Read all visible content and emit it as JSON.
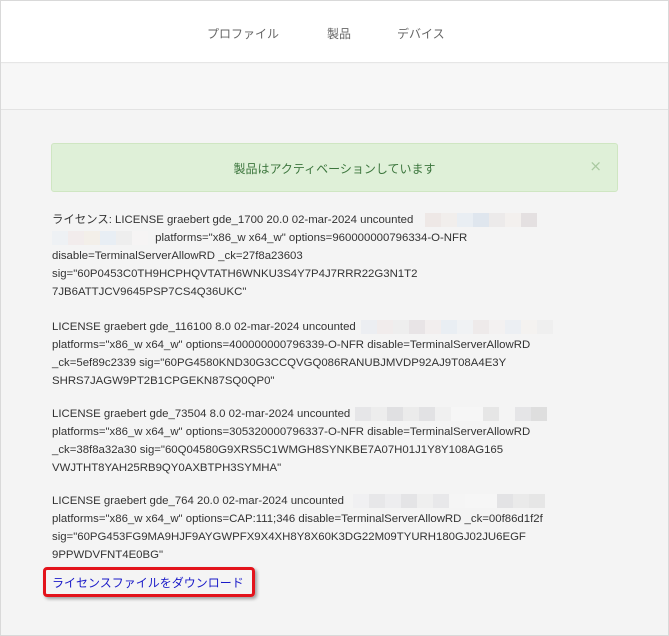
{
  "nav": {
    "profile": "プロファイル",
    "products": "製品",
    "devices": "デバイス"
  },
  "alert": {
    "message": "製品はアクティベーションしています",
    "close": "×"
  },
  "licenses": [
    {
      "l1": "ライセンス: LICENSE graebert gde_1700 20.0 02-mar-2024 uncounted",
      "l2": "platforms=\"x86_w x64_w\" options=960000000796334-O-NFR",
      "l3": "disable=TerminalServerAllowRD _ck=27f8a23603",
      "l4": "sig=\"60P0453C0TH9HCPHQVTATH6WNKU3S4Y7P4J7RRR22G3N1T2",
      "l5": "7JB6ATTJCV9645PSP7CS4Q36UKC\""
    },
    {
      "l1": "LICENSE graebert gde_116100 8.0 02-mar-2024 uncounted",
      "l2": "platforms=\"x86_w x64_w\" options=400000000796339-O-NFR disable=TerminalServerAllowRD",
      "l3": "_ck=5ef89c2339 sig=\"60PG4580KND30G3CCQVGQ086RANUBJMVDP92AJ9T08A4E3Y",
      "l4": "SHRS7JAGW9PT2B1CPGEKN87SQ0QP0\""
    },
    {
      "l1": "LICENSE graebert gde_73504 8.0 02-mar-2024 uncounted",
      "l2": "platforms=\"x86_w x64_w\" options=305320000796337-O-NFR disable=TerminalServerAllowRD",
      "l3": "_ck=38f8a32a30 sig=\"60Q04580G9XRS5C1WMGH8SYNKBE7A07H01J1Y8Y108AG165",
      "l4": "VWJTHT8YAH25RB9QY0AXBTPH3SYMHA\""
    },
    {
      "l1": "LICENSE graebert gde_764 20.0 02-mar-2024 uncounted",
      "l2": "platforms=\"x86_w x64_w\" options=CAP:111;346 disable=TerminalServerAllowRD _ck=00f86d1f2f",
      "l3": "sig=\"60PG453FG9MA9HJF9AYGWPFX9X4XH8Y8X60K3DG22M09TYURH180GJ02JU6EGF",
      "l4": "9PPWDVFNT4E0BG\""
    }
  ],
  "download": {
    "label": "ライセンスファイルをダウンロード"
  },
  "colors": {
    "alert_bg": "#dff0d8",
    "alert_text": "#3c763d",
    "link": "#1a1ac8",
    "highlight": "#e3131b"
  }
}
